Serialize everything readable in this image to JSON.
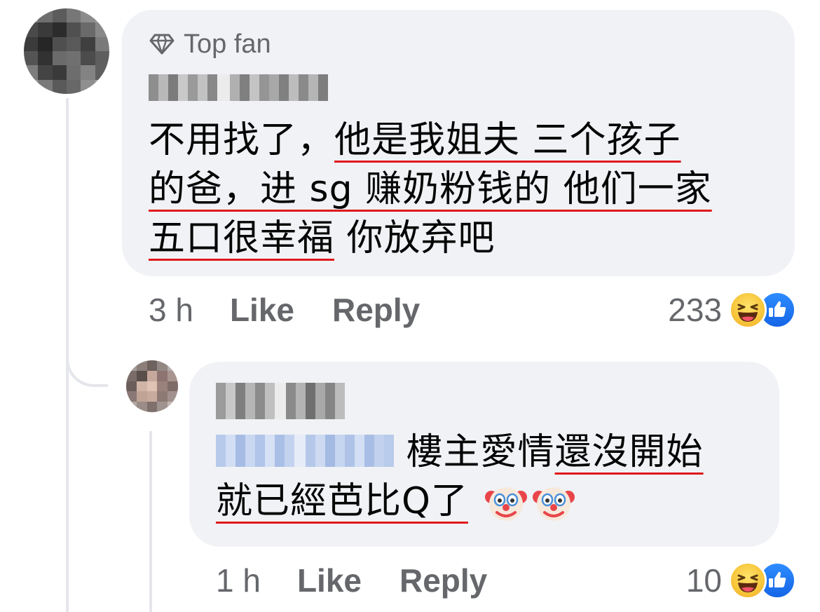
{
  "comment1": {
    "badge_label": "Top fan",
    "text_plain1": "不用找了，",
    "text_ul1": "他是我姐夫 三个孩子",
    "text_ul2": "的爸，进 sg 赚奶粉钱的 他们一家",
    "text_ul3": "五口很幸福",
    "text_plain2": " 你放弃吧",
    "time": "3 h",
    "like_label": "Like",
    "reply_label": "Reply",
    "reaction_count": "233"
  },
  "comment2": {
    "text_plain1": " 樓主愛情",
    "text_ul1": "還沒開始",
    "text_ul2": "就已經芭比Q了",
    "emojis": [
      "clown-face",
      "clown-face"
    ],
    "time": "1 h",
    "like_label": "Like",
    "reply_label": "Reply",
    "reaction_count": "10"
  },
  "colors": {
    "bubble": "#f0f2f5",
    "meta_text": "#65676b",
    "underline": "#e0181c",
    "like_blue": "#1877f2",
    "haha_yellow": "#f7c53a"
  }
}
